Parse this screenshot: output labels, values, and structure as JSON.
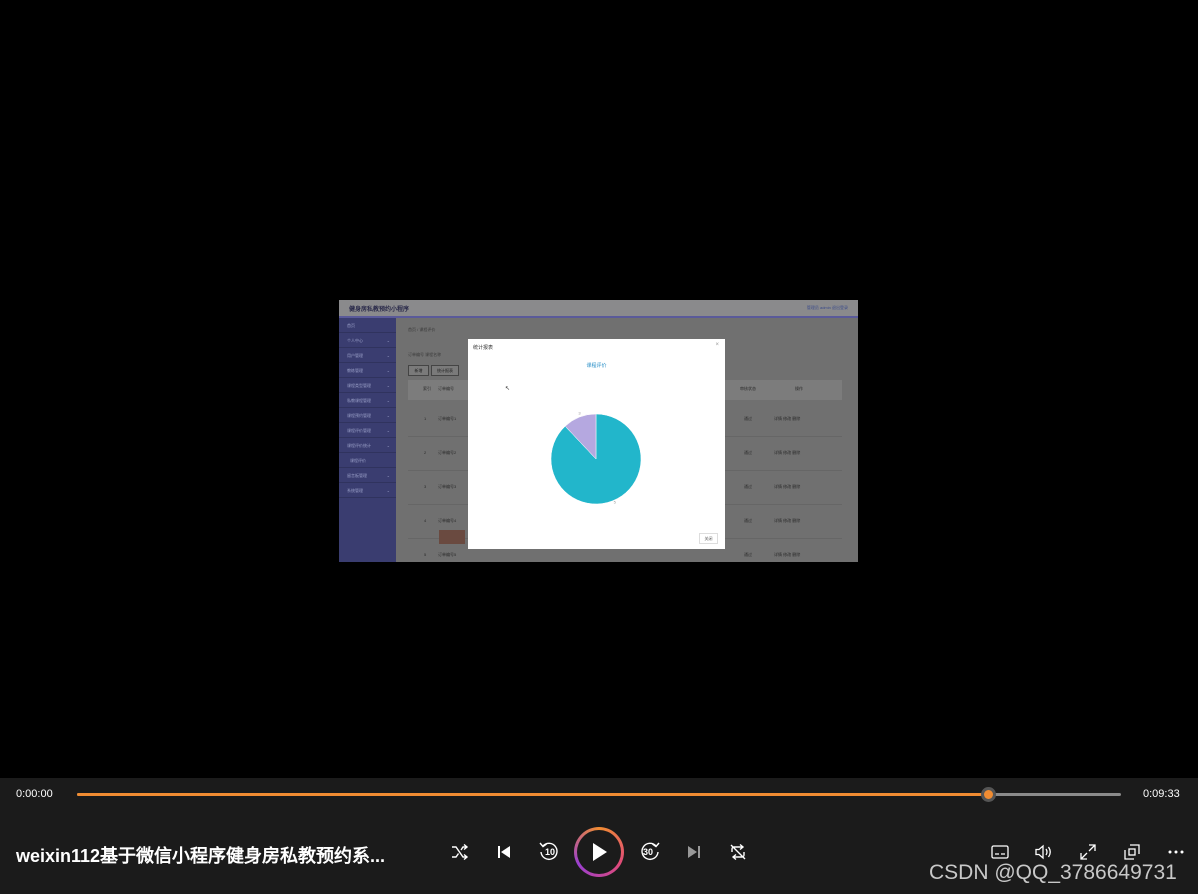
{
  "frame": {
    "app_title": "健身房私教预约小程序",
    "header_right": "管理员 admin   退出登录",
    "sidebar": [
      "首页",
      "个人中心",
      "用户管理",
      "教练管理",
      "课程类型管理",
      "私教课程管理",
      "课程预约管理",
      "课程评价管理",
      "课程评价统计",
      "课程评价",
      "留言板管理",
      "系统管理"
    ],
    "breadcrumb": "首页 / 课程评价",
    "tabs": "订单编号   课程名称",
    "buttons": [
      "新增",
      "统计报表"
    ],
    "table_head": [
      "索引",
      "订单编号",
      "审核状态",
      "操作"
    ],
    "rows": [
      {
        "index": "1",
        "order": "订单编号1",
        "status": "通过",
        "ops": "详情  修改  删除"
      },
      {
        "index": "2",
        "order": "订单编号2",
        "status": "通过",
        "ops": "详情  修改  删除"
      },
      {
        "index": "3",
        "order": "订单编号3",
        "status": "通过",
        "ops": "详情  修改  删除"
      },
      {
        "index": "4",
        "order": "订单编号4",
        "status": "通过",
        "ops": "详情  修改  删除"
      },
      {
        "index": "5",
        "order": "订单编号5",
        "status": "通过",
        "ops": "详情  修改  删除"
      }
    ],
    "modal": {
      "title": "统计报表",
      "close": "×",
      "chart_title": "课程评价",
      "button": "关闭"
    }
  },
  "chart_data": {
    "type": "pie",
    "title": "课程评价",
    "slices": [
      {
        "label": "5",
        "value": 0.88,
        "color": "#22b6cb"
      },
      {
        "label": "3",
        "value": 0.12,
        "color": "#b5a8e0"
      }
    ]
  },
  "player": {
    "current_time": "0:00:00",
    "total_time": "0:09:33",
    "progress": 0.873,
    "video_title": "weixin112基于微信小程序健身房私教预约系...",
    "skip_back_seconds": "10",
    "skip_forward_seconds": "30",
    "watermark": "CSDN @QQ_3786649731",
    "accent_color": "#f08c32"
  }
}
